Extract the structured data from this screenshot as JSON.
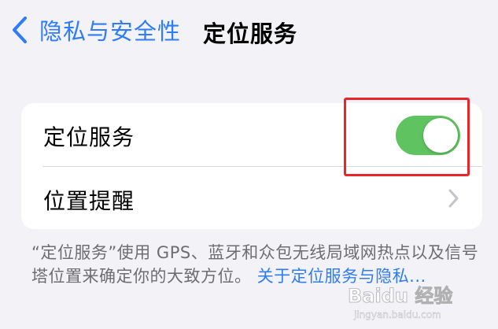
{
  "nav": {
    "back_label": "隐私与安全性",
    "title": "定位服务"
  },
  "settings": {
    "location_services": {
      "label": "定位服务",
      "enabled": true
    },
    "location_alerts": {
      "label": "位置提醒"
    }
  },
  "footer": {
    "description": "“定位服务”使用 GPS、蓝牙和众包无线局域网热点以及信号塔位置来确定你的大致方位。",
    "link": "关于定位服务与隐私..."
  },
  "watermark": {
    "text": "Baidu 经验",
    "url": "jingyan.baidu.com"
  },
  "colors": {
    "accent_blue": "#2f7cf6",
    "toggle_green": "#5fc35f",
    "highlight_red": "#e8262a",
    "background": "#f2f2f7"
  },
  "icons": {
    "back": "chevron-left-icon",
    "row_disclosure": "chevron-right-icon"
  }
}
